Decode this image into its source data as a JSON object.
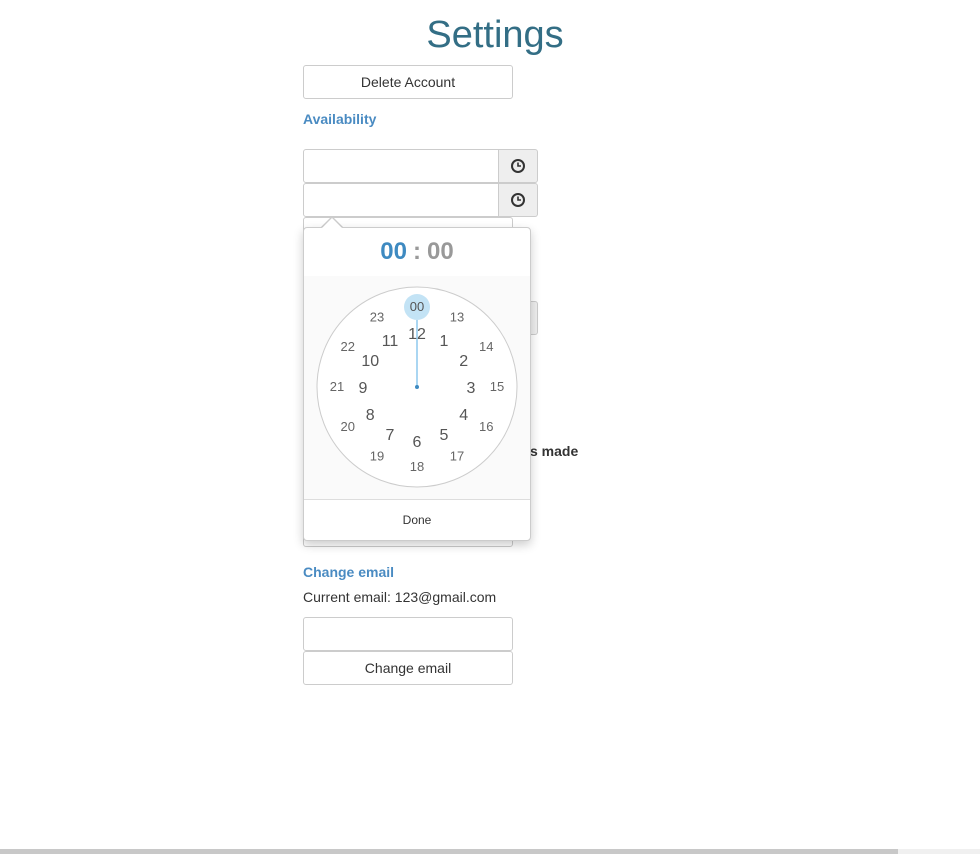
{
  "page": {
    "title": "Settings"
  },
  "account": {
    "delete_label": "Delete Account"
  },
  "availability": {
    "heading": "Availability",
    "clock_icon": "clock-icon"
  },
  "hidden": {
    "fragment": "s made"
  },
  "timepicker": {
    "hours": "00",
    "separator": ":",
    "minutes": "00",
    "done_label": "Done",
    "selected_hour": "00",
    "outer_hours": [
      "00",
      "13",
      "14",
      "15",
      "16",
      "17",
      "18",
      "19",
      "20",
      "21",
      "22",
      "23"
    ],
    "inner_hours": [
      "12",
      "1",
      "2",
      "3",
      "4",
      "5",
      "6",
      "7",
      "8",
      "9",
      "10",
      "11"
    ]
  },
  "email": {
    "heading": "Change email",
    "current_label": "Current email: 123@gmail.com",
    "input_value": "",
    "change_label": "Change email"
  },
  "colors": {
    "accent": "#3e8ac1",
    "title": "#336e85",
    "highlight": "#c3e3f5"
  }
}
